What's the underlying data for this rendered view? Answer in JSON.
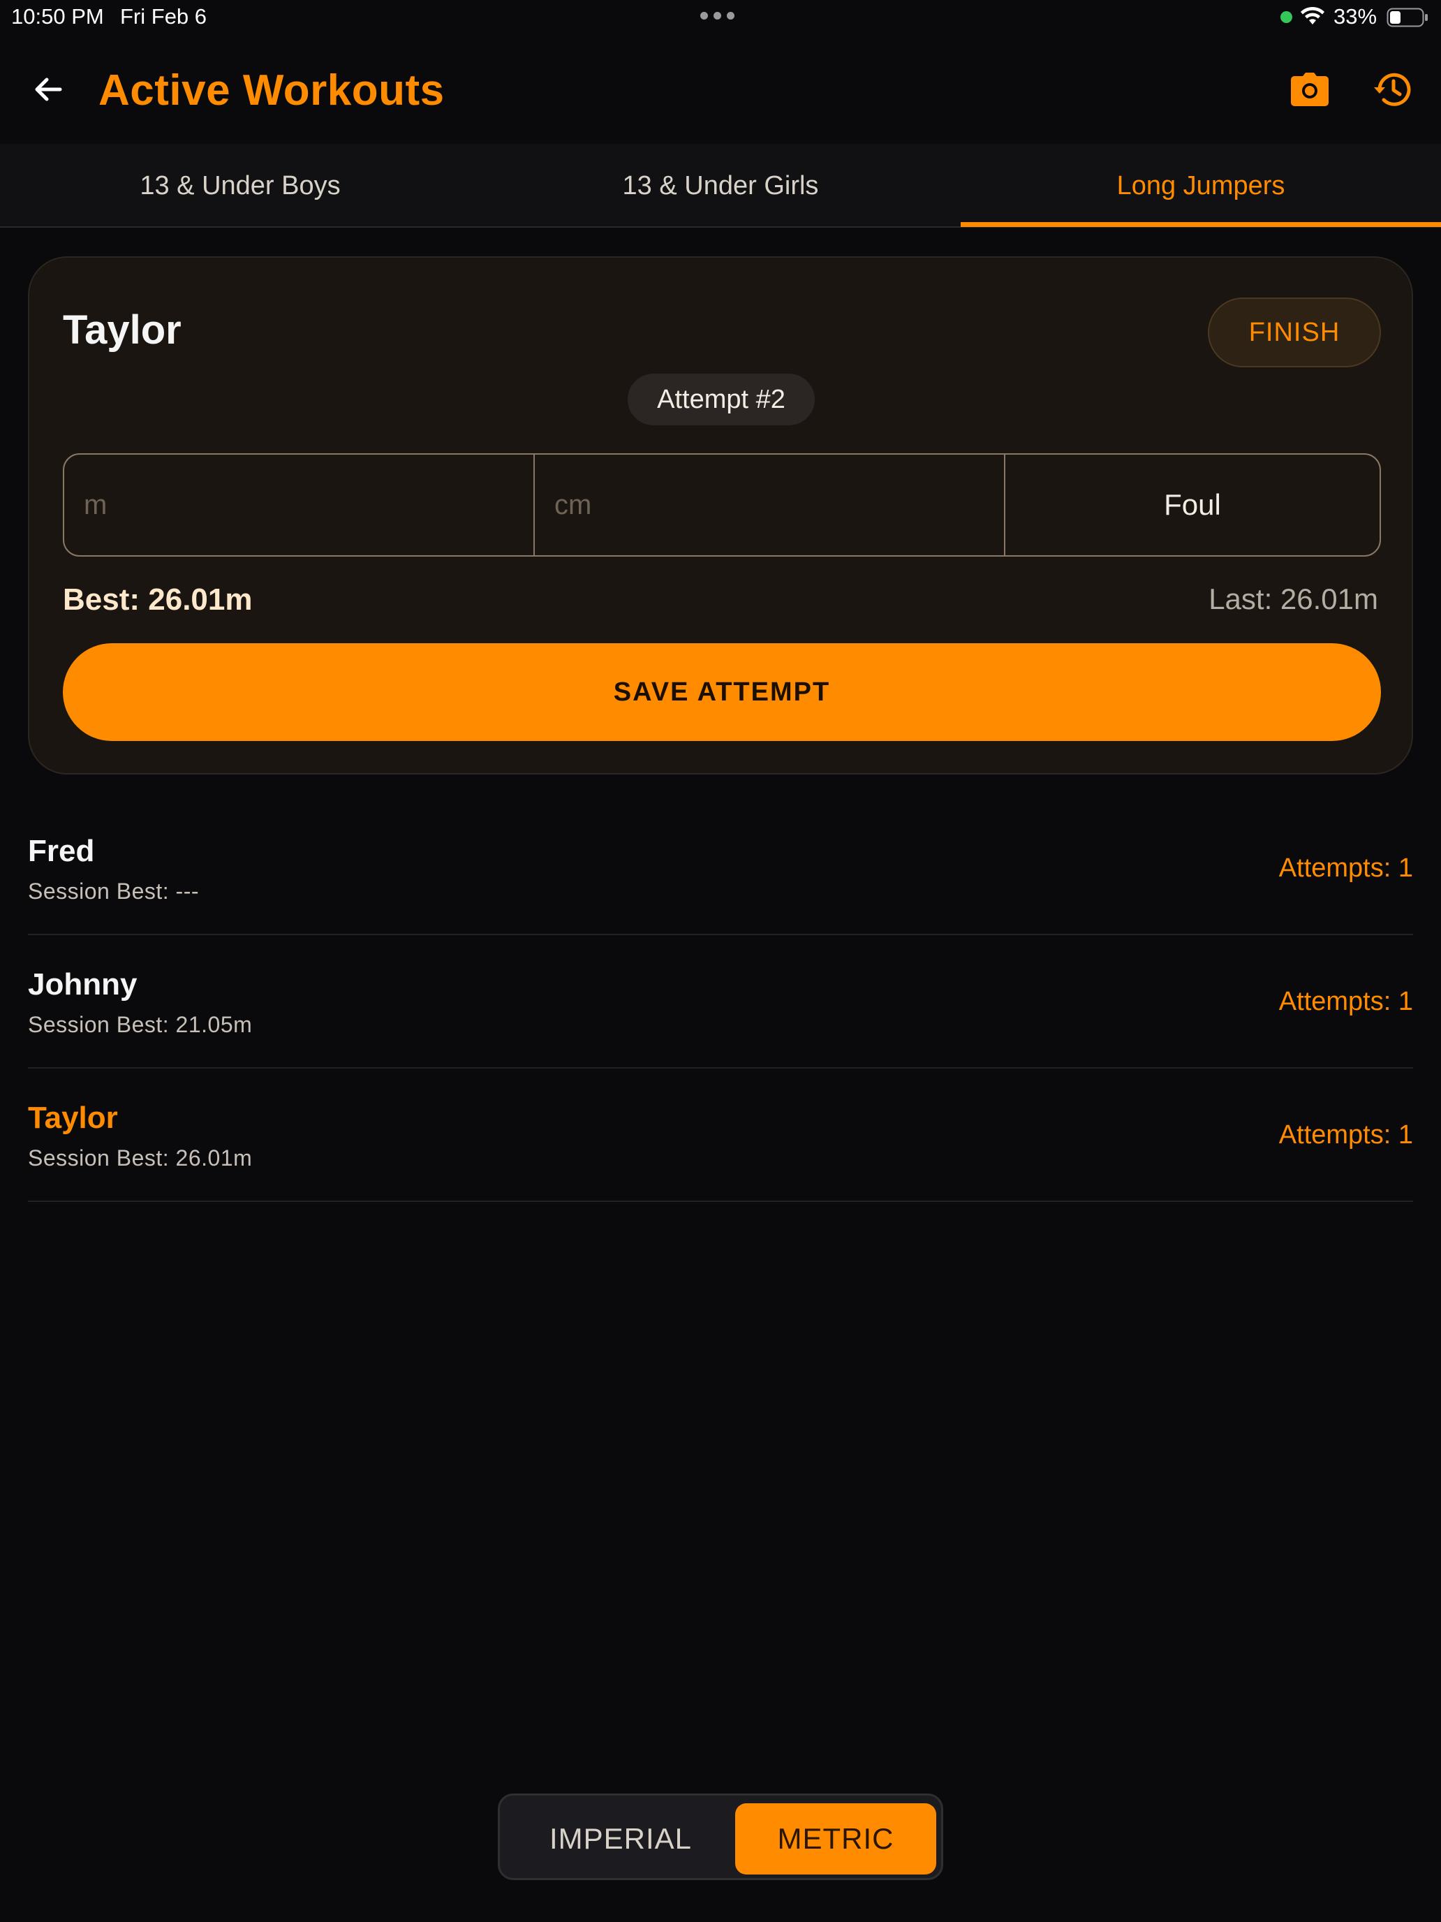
{
  "status_bar": {
    "time": "10:50 PM",
    "date": "Fri Feb 6",
    "battery_percent": "33%"
  },
  "header": {
    "title": "Active Workouts",
    "back_icon": "arrow-left-icon",
    "camera_icon": "camera-icon",
    "history_icon": "history-icon"
  },
  "tabs": [
    {
      "label": "13 & Under Boys",
      "active": false
    },
    {
      "label": "13 & Under Girls",
      "active": false
    },
    {
      "label": "Long Jumpers",
      "active": true
    }
  ],
  "active_athlete": {
    "name": "Taylor",
    "finish_label": "FINISH",
    "attempt_label": "Attempt #2",
    "meters_value": "",
    "meters_placeholder": "m",
    "cm_value": "",
    "cm_placeholder": "cm",
    "foul_label": "Foul",
    "best_text": "Best: 26.01m",
    "last_text": "Last: 26.01m",
    "save_label": "SAVE ATTEMPT"
  },
  "athletes": [
    {
      "name": "Fred",
      "session_best": "Session Best: ---",
      "attempts": "Attempts: 1",
      "current": false
    },
    {
      "name": "Johnny",
      "session_best": "Session Best: 21.05m",
      "attempts": "Attempts: 1",
      "current": false
    },
    {
      "name": "Taylor",
      "session_best": "Session Best: 26.01m",
      "attempts": "Attempts: 1",
      "current": true
    }
  ],
  "unit_toggle": {
    "imperial_label": "IMPERIAL",
    "metric_label": "METRIC",
    "selected": "METRIC"
  },
  "colors": {
    "accent": "#ff8c00",
    "background": "#0a0a0c",
    "card": "#1a1511",
    "status_dot": "#34c759"
  }
}
